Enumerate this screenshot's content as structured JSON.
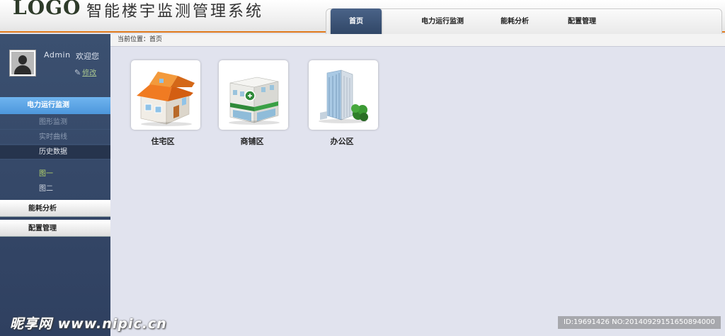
{
  "header": {
    "logo": "LOGO",
    "title": "智能楼宇监测管理系统",
    "nav": [
      {
        "label": "首页"
      },
      {
        "label": "电力运行监测"
      },
      {
        "label": "能耗分析"
      },
      {
        "label": "配置管理"
      }
    ]
  },
  "user": {
    "name": "Admin",
    "welcome": "欢迎您",
    "edit": "修改"
  },
  "sidebar": {
    "active_menu": "电力运行监测",
    "sub_items": [
      "图形监测",
      "实时曲线",
      "历史数据"
    ],
    "leaves": [
      "图一",
      "图二"
    ],
    "menus": [
      "能耗分析",
      "配置管理"
    ]
  },
  "breadcrumb": "当前位置：首页",
  "areas": [
    {
      "label": "住宅区",
      "icon": "house-icon"
    },
    {
      "label": "商铺区",
      "icon": "shop-icon"
    },
    {
      "label": "办公区",
      "icon": "office-building-icon"
    }
  ],
  "watermark": {
    "site": "昵享网 www.nipic.cn",
    "id": "ID:19691426 NO:20140929151650894000"
  },
  "colors": {
    "accent": "#e07a1c",
    "sidebar": "#34476a",
    "active_menu": "#5ba4e3",
    "content_bg": "#e1e3ee"
  }
}
